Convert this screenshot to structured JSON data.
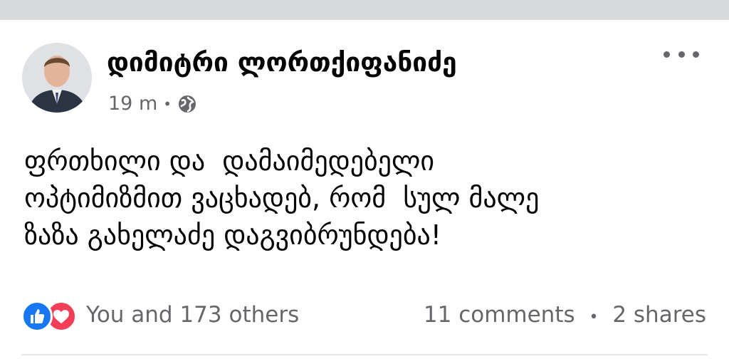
{
  "post": {
    "author": "დიმიტრი ლორთქიფანიძე",
    "timestamp": "19 m",
    "privacy_icon": "globe-icon",
    "more_icon": "more-horizontal-icon",
    "body_lines": [
      "ფრთხილი და  დამაიმედებელი",
      "ოპტიმიზმით ვაცხადებ, რომ  სულ მალე",
      "ზაზა გახელაძე დაგვიბრუნდება!"
    ]
  },
  "engagement": {
    "reactions": [
      "like-reaction-icon",
      "love-reaction-icon"
    ],
    "reactions_text": "You and 173 others",
    "comments": "11 comments",
    "shares": "2 shares"
  },
  "colors": {
    "like": "#1877f2",
    "love": "#f33e58",
    "secondary_text": "#65676b",
    "primary_text": "#050505"
  }
}
